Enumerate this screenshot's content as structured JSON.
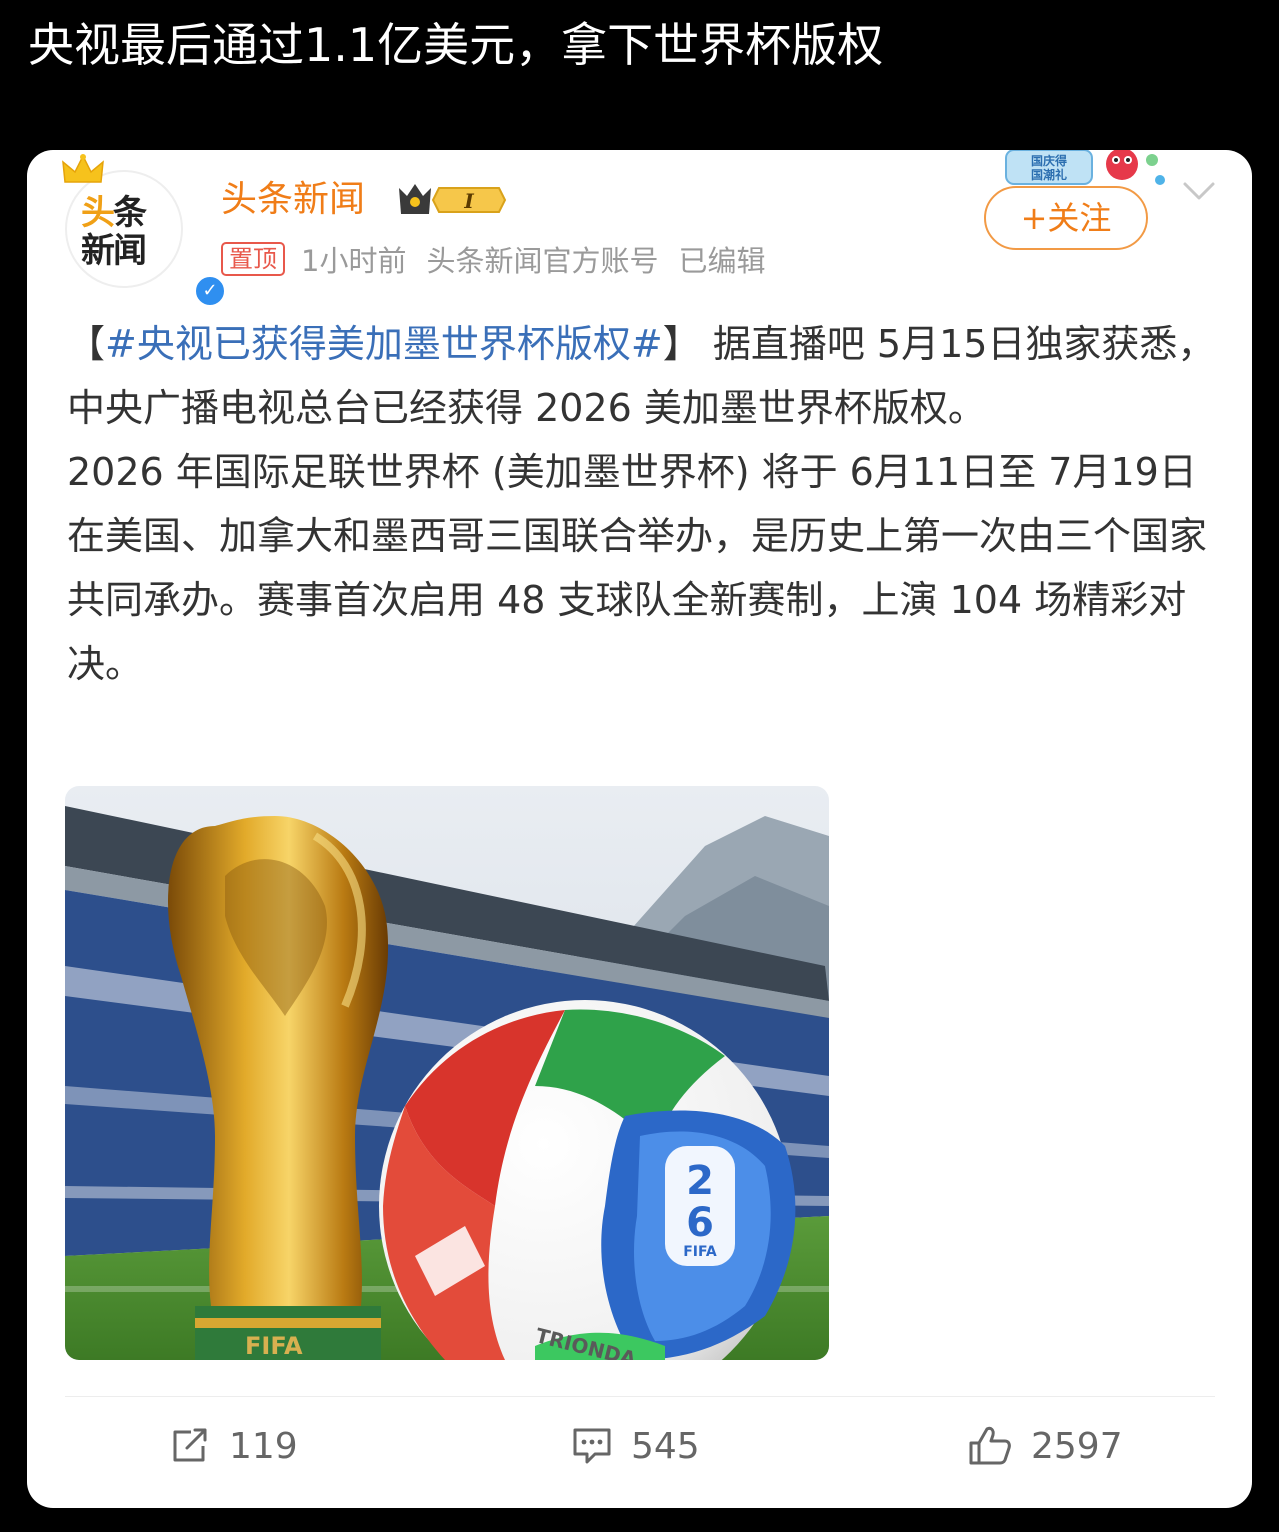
{
  "caption": "央视最后通过1.1亿美元，拿下世界杯版权",
  "author": {
    "name": "头条新闻",
    "avatar_text_top_a": "头",
    "avatar_text_top_b": "条",
    "avatar_text_bottom": "新闻",
    "level_badge": "I"
  },
  "meta": {
    "pinned": "置顶",
    "time": "1小时前",
    "source": "头条新闻官方账号",
    "edited": "已编辑"
  },
  "follow_label": "+关注",
  "event_sticker_text": "国庆得国潮礼",
  "post": {
    "open_bracket": "【",
    "hashtag": "#央视已获得美加墨世界杯版权#",
    "close_bracket": "】",
    "para1_rest": "据直播吧 5月15日独家获悉，中央广播电视总台已经获得 2026 美加墨世界杯版权。",
    "para2": "2026 年国际足联世界杯 (美加墨世界杯) 将于 6月11日至 7月19日在美国、加拿大和墨西哥三国联合举办，是历史上第一次由三个国家共同承办。赛事首次启用 48 支球队全新赛制，上演 104 场精彩对决。"
  },
  "image": {
    "ball_brand": "FIFA",
    "ball_name": "TRIONDA",
    "trophy_base_text": "FIFA"
  },
  "actions": {
    "share_count": "119",
    "comment_count": "545",
    "like_count": "2597"
  },
  "colors": {
    "brand_orange": "#f07d18",
    "hashtag_blue": "#3a6fb8",
    "pin_red": "#e8584b",
    "meta_gray": "#9a9a9a"
  }
}
